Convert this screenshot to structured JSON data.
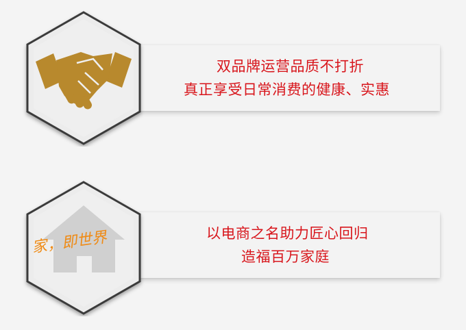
{
  "colors": {
    "accent_text": "#d8161c",
    "gold_icon": "#b8892d",
    "house_gray": "#d0d0d0",
    "hex_border": "#3a3a3a",
    "slogan": "#ef8a14"
  },
  "features": [
    {
      "icon": "handshake-icon",
      "lines": [
        "双品牌运营品质不打折",
        "真正享受日常消费的健康、实惠"
      ]
    },
    {
      "icon": "house-icon",
      "slogan": "家，即世界",
      "lines": [
        "以电商之名助力匠心回归",
        "造福百万家庭"
      ]
    }
  ]
}
